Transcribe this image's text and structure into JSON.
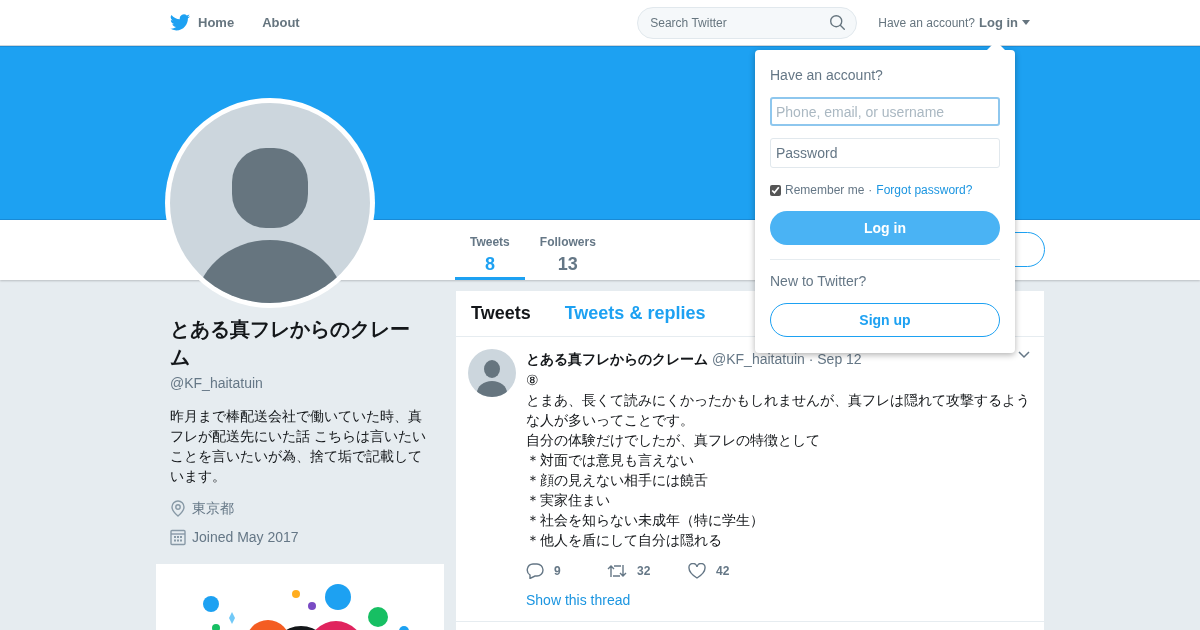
{
  "nav": {
    "items": [
      {
        "label": "Home",
        "kind": "home"
      },
      {
        "label": "About",
        "kind": "plain"
      }
    ],
    "search": {
      "placeholder": "Search Twitter"
    },
    "account_prompt": "Have an account?",
    "login": "Log in"
  },
  "stats": [
    {
      "label": "Tweets",
      "value": "8",
      "selected": true
    },
    {
      "label": "Followers",
      "value": "13",
      "selected": false
    }
  ],
  "profile": {
    "name": "とある真フレからのクレーム",
    "handle": "@KF_haitatuin",
    "bio": "昨月まで棒配送会社で働いていた時、真フレが配送先にいた話 こちらは言いたいことを言いたいが為、捨て垢で記載しています。",
    "location": "東京都",
    "joined": "Joined May 2017"
  },
  "timeline_tabs": [
    {
      "label": "Tweets",
      "selected": true
    },
    {
      "label": "Tweets & replies",
      "selected": false
    }
  ],
  "tweet": {
    "author": "とある真フレからのクレーム",
    "handle_time": "@KF_haitatuin · Sep 12",
    "lines": [
      "⑧",
      "とまあ、長くて読みにくかったかもしれませんが、真フレは隠れて攻撃するような人が多いってことです。",
      "自分の体験だけでしたが、真フレの特徴として",
      "＊対面では意見も言えない",
      "＊顔の見えない相手には饒舌",
      "＊実家住まい",
      "＊社会を知らない未成年（特に学生）",
      "＊他人を盾にして自分は隠れる"
    ],
    "actions": [
      {
        "kind": "reply",
        "count": "9"
      },
      {
        "kind": "retweet",
        "count": "32"
      },
      {
        "kind": "like",
        "count": "42"
      }
    ],
    "thread_link": "Show this thread"
  },
  "login_dropdown": {
    "title": "Have an account?",
    "username_placeholder": "Phone, email, or username",
    "password_placeholder": "Password",
    "remember_me": "Remember me",
    "remember_checked": true,
    "separator": "·",
    "forgot": "Forgot password?",
    "login_button": "Log in",
    "new_prompt": "New to Twitter?",
    "signup_button": "Sign up"
  }
}
